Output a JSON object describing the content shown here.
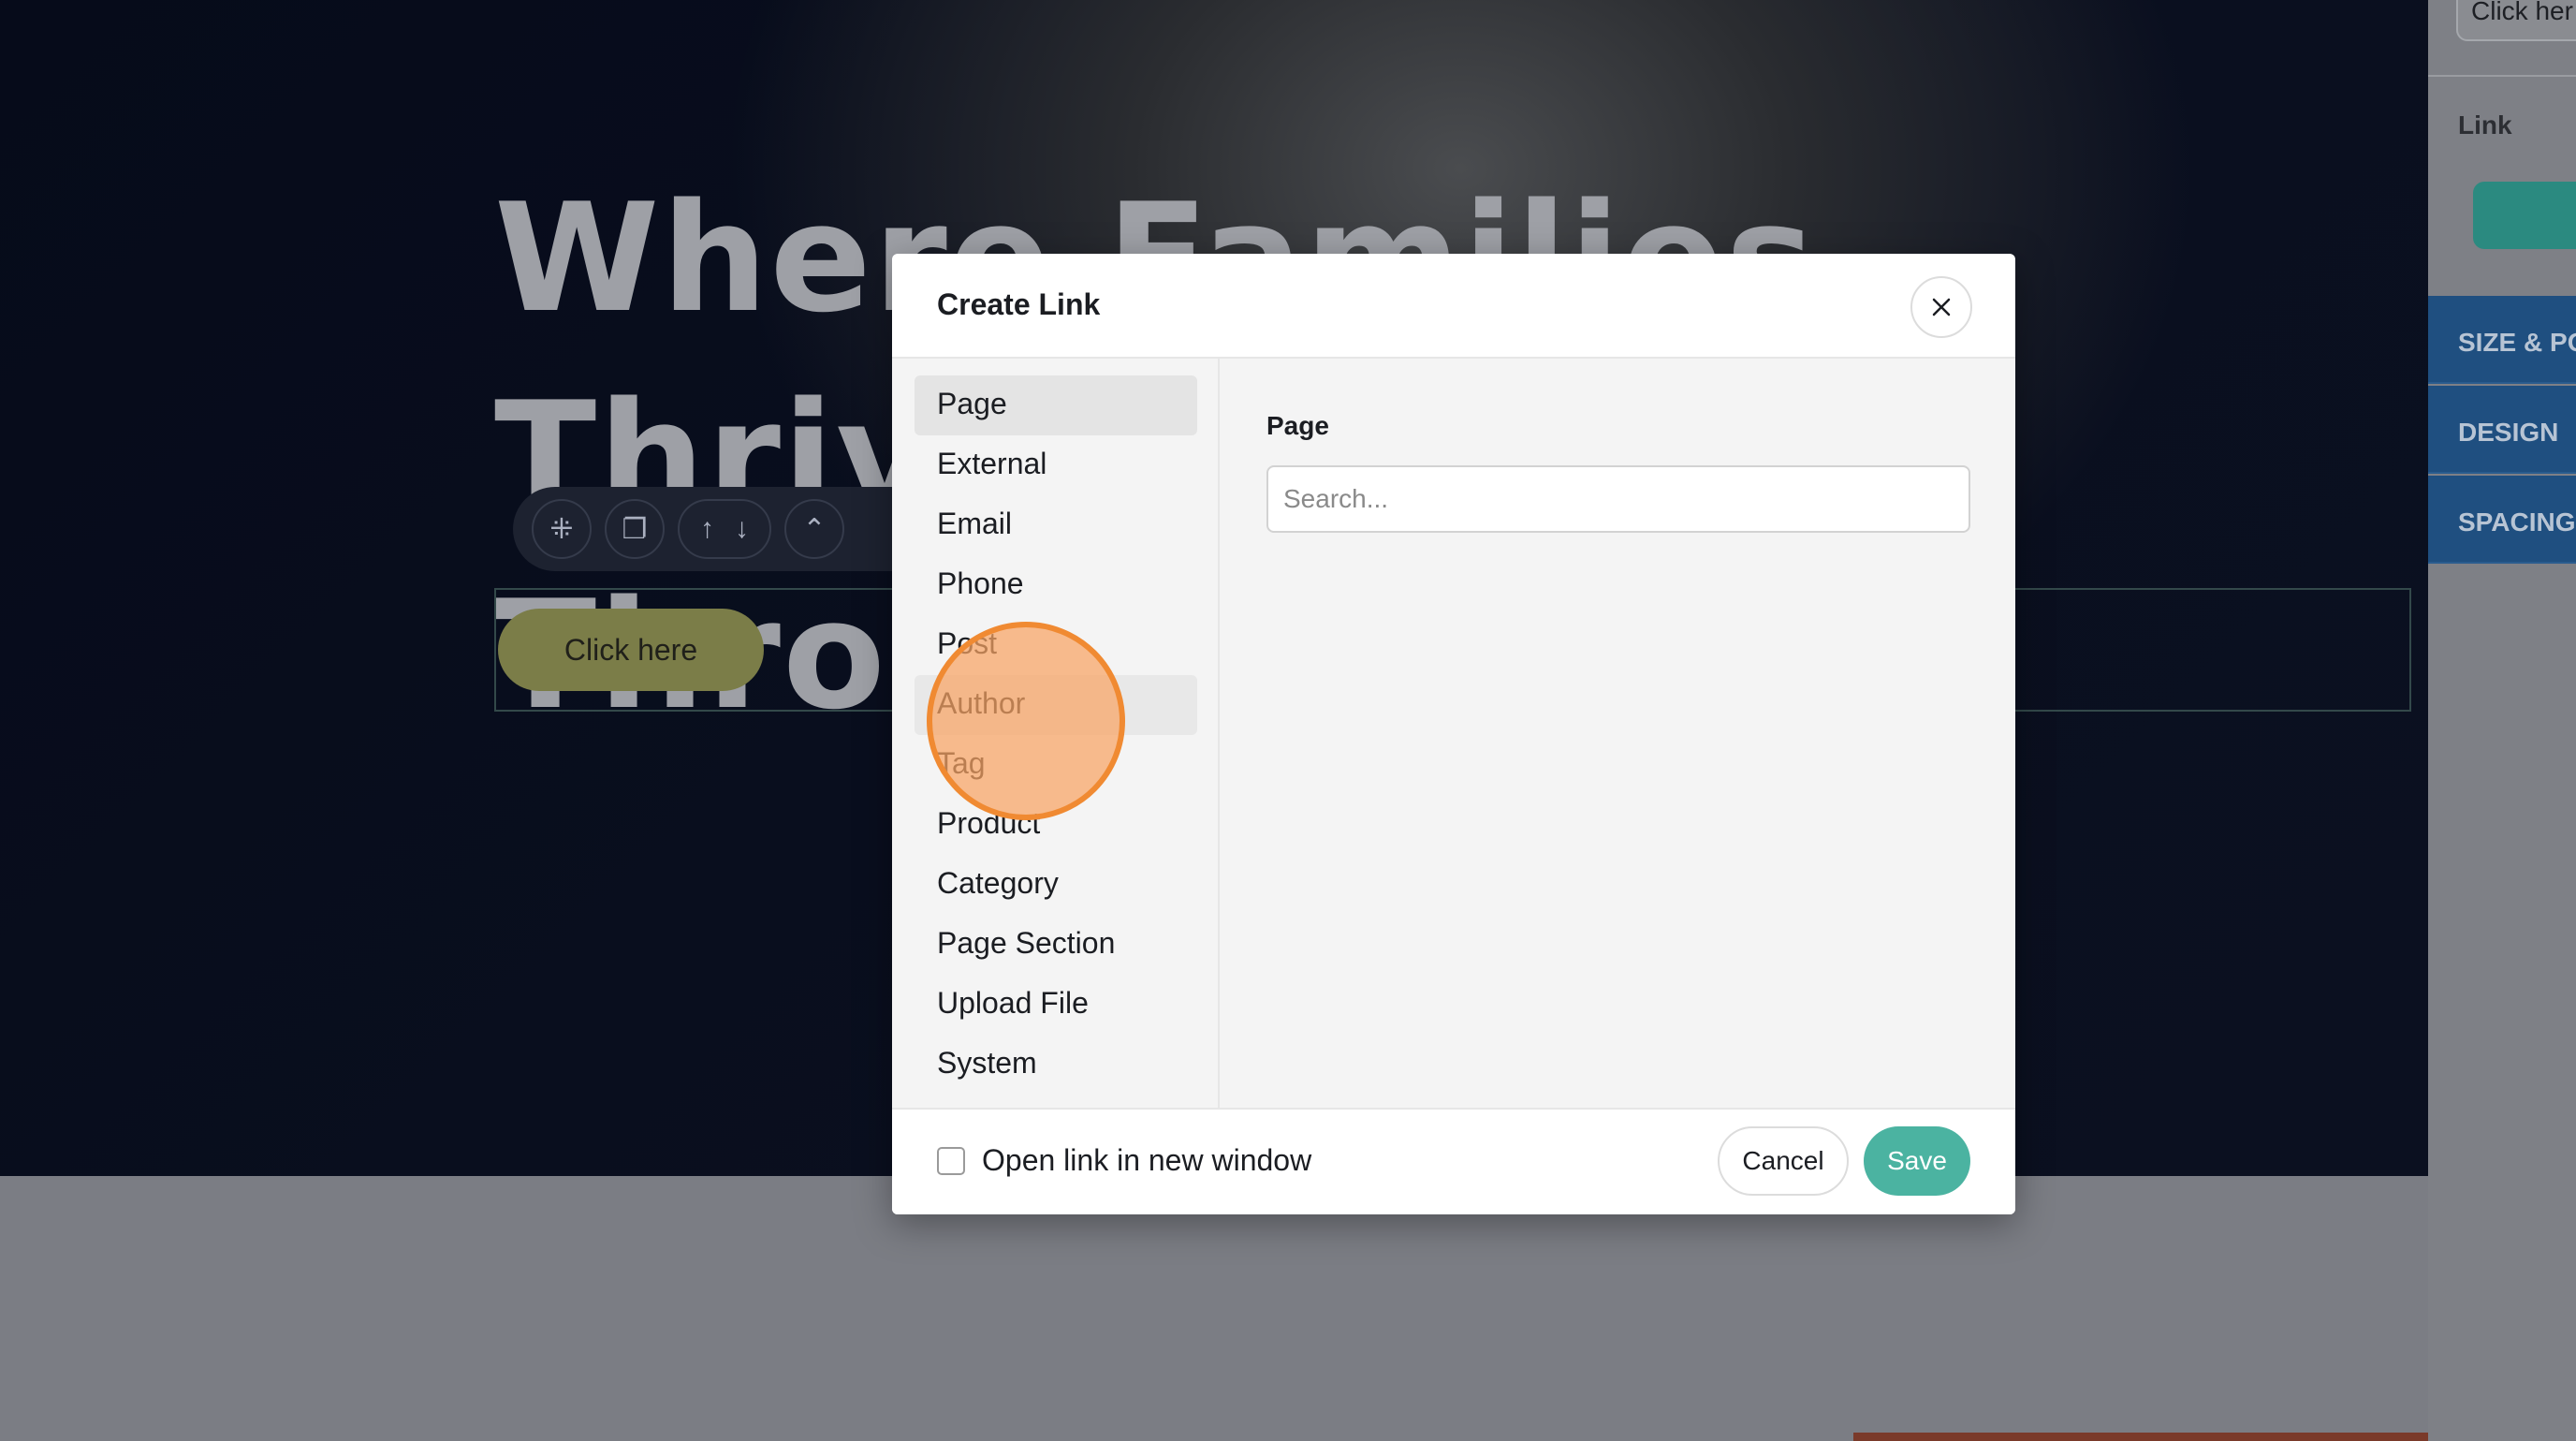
{
  "hero": {
    "heading": "Where Families Thrive\nThrou",
    "button_label": "Click here"
  },
  "editor_toolbar": {
    "icons": [
      "add-block-icon",
      "duplicate-icon",
      "move-up-icon",
      "move-down-icon",
      "move-to-top-icon"
    ],
    "glyphs": {
      "add": "⁜",
      "duplicate": "❐",
      "up": "↑",
      "down": "↓",
      "top": "⌃"
    }
  },
  "right_panel": {
    "click_input_value": "Click her",
    "link_label": "Link",
    "accordions": [
      "SIZE & PO",
      "DESIGN",
      "SPACING"
    ],
    "accent_color": "#1f4f80"
  },
  "modal": {
    "title": "Create Link",
    "close_glyph": "✕",
    "link_types": [
      "Page",
      "External",
      "Email",
      "Phone",
      "Post",
      "Author",
      "Tag",
      "Product",
      "Category",
      "Page Section",
      "Upload File",
      "System"
    ],
    "selected_type": "Page",
    "hovered_type": "Author",
    "detail_label": "Page",
    "search": {
      "placeholder": "Search...",
      "value": ""
    },
    "new_window_label": "Open link in new window",
    "new_window_checked": false,
    "cancel_label": "Cancel",
    "save_label": "Save",
    "save_color": "#4bb3a1"
  }
}
